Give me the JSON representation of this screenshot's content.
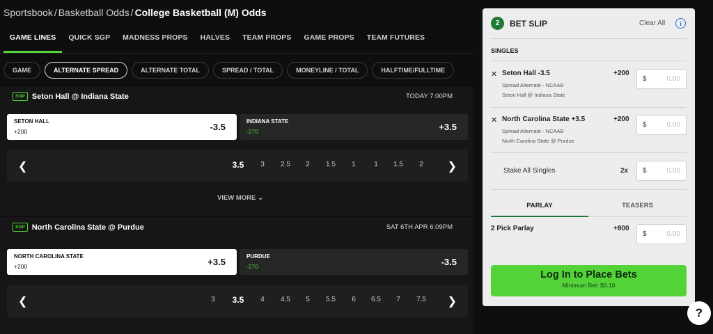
{
  "breadcrumb": {
    "items": [
      "Sportsbook",
      "Basketball Odds"
    ],
    "current": "College Basketball (M) Odds"
  },
  "tabs": [
    "GAME LINES",
    "QUICK SGP",
    "MADNESS PROPS",
    "HALVES",
    "TEAM PROPS",
    "GAME PROPS",
    "TEAM FUTURES"
  ],
  "pills": [
    "GAME",
    "ALTERNATE SPREAD",
    "ALTERNATE TOTAL",
    "SPREAD / TOTAL",
    "MONEYLINE / TOTAL",
    "HALFTIME/FULLTIME"
  ],
  "colors": {
    "accent": "#53d337",
    "dark_green": "#1f7a34",
    "info_blue": "#2b6fd6"
  },
  "events": [
    {
      "badge": "SGP",
      "title": "Seton Hall @ Indiana State",
      "time": "TODAY 7:00PM",
      "home": {
        "team": "SETON HALL",
        "price": "+200",
        "line": "-3.5"
      },
      "away": {
        "team": "INDIANA STATE",
        "price": "-270",
        "line": "+3.5"
      },
      "alt_lines": [
        "3.5",
        "3",
        "2.5",
        "2",
        "1.5",
        "1",
        "1",
        "1.5",
        "2"
      ],
      "selected_index": 0,
      "view_more": "VIEW MORE"
    },
    {
      "badge": "SGP",
      "title": "North Carolina State @ Purdue",
      "time": "SAT 6TH APR 6:09PM",
      "home": {
        "team": "NORTH CAROLINA STATE",
        "price": "+200",
        "line": "+3.5"
      },
      "away": {
        "team": "PURDUE",
        "price": "-270",
        "line": "-3.5"
      },
      "alt_lines": [
        "3",
        "3.5",
        "4",
        "4.5",
        "5",
        "5.5",
        "6",
        "6.5",
        "7",
        "7.5"
      ],
      "selected_index": 1
    }
  ],
  "bet_slip": {
    "count": "2",
    "title": "BET SLIP",
    "clear_all": "Clear All",
    "singles_label": "SINGLES",
    "bets": [
      {
        "selection": "Seton Hall -3.5",
        "odds": "+200",
        "market": "Spread Alternate - NCAAB",
        "event": "Seton Hall @ Indiana State",
        "currency": "$",
        "placeholder": "0.00"
      },
      {
        "selection": "North Carolina State +3.5",
        "odds": "+200",
        "market": "Spread Alternate - NCAAB",
        "event": "North Carolina State @ Purdue",
        "currency": "$",
        "placeholder": "0.00"
      }
    ],
    "stake_all": {
      "label": "Stake All Singles",
      "multiplier": "2x",
      "currency": "$",
      "placeholder": "0.00"
    },
    "tabs": [
      "PARLAY",
      "TEASERS"
    ],
    "parlay": {
      "label": "2 Pick Parlay",
      "odds": "+800",
      "currency": "$",
      "placeholder": "0.00"
    },
    "login_button": "Log In to Place Bets",
    "min_bet": "Minimum Bet: $0.10"
  },
  "help_label": "?"
}
